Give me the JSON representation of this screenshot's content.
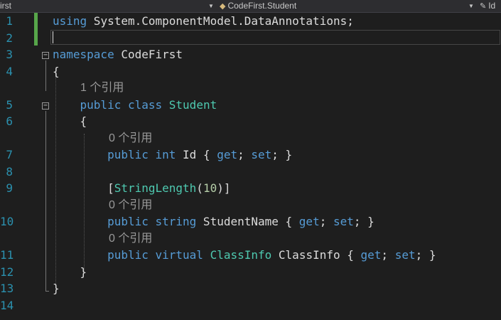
{
  "navbar": {
    "project_dropdown": "irst",
    "type_dropdown": "CodeFirst.Student",
    "member_dropdown": "Id"
  },
  "lines": [
    {
      "num": "1",
      "tokens": [
        {
          "t": "using",
          "c": "kw"
        },
        {
          "t": " System.ComponentModel.DataAnnotations;",
          "c": "pl"
        }
      ]
    },
    {
      "num": "2",
      "tokens": []
    },
    {
      "num": "3",
      "tokens": [
        {
          "t": "namespace",
          "c": "kw"
        },
        {
          "t": " CodeFirst",
          "c": "pl"
        }
      ]
    },
    {
      "num": "4",
      "tokens": [
        {
          "t": "{",
          "c": "pl"
        }
      ]
    },
    {
      "num": "",
      "lens": "1 个引用"
    },
    {
      "num": "5",
      "tokens": [
        {
          "t": "    public",
          "c": "kw"
        },
        {
          "t": " ",
          "c": "pl"
        },
        {
          "t": "class",
          "c": "kw"
        },
        {
          "t": " ",
          "c": "pl"
        },
        {
          "t": "Student",
          "c": "ty"
        }
      ]
    },
    {
      "num": "6",
      "tokens": [
        {
          "t": "    {",
          "c": "pl"
        }
      ]
    },
    {
      "num": "",
      "lens": "0 个引用"
    },
    {
      "num": "7",
      "tokens": [
        {
          "t": "        public",
          "c": "kw"
        },
        {
          "t": " ",
          "c": "pl"
        },
        {
          "t": "int",
          "c": "kw"
        },
        {
          "t": " Id { ",
          "c": "pl"
        },
        {
          "t": "get",
          "c": "kw"
        },
        {
          "t": "; ",
          "c": "pl"
        },
        {
          "t": "set",
          "c": "kw"
        },
        {
          "t": "; }",
          "c": "pl"
        }
      ]
    },
    {
      "num": "8",
      "tokens": []
    },
    {
      "num": "9",
      "tokens": [
        {
          "t": "        [",
          "c": "pl"
        },
        {
          "t": "StringLength",
          "c": "ty"
        },
        {
          "t": "(",
          "c": "pl"
        },
        {
          "t": "10",
          "c": "nm"
        },
        {
          "t": ")]",
          "c": "pl"
        }
      ]
    },
    {
      "num": "",
      "lens": "0 个引用"
    },
    {
      "num": "10",
      "tokens": [
        {
          "t": "        public",
          "c": "kw"
        },
        {
          "t": " ",
          "c": "pl"
        },
        {
          "t": "string",
          "c": "kw"
        },
        {
          "t": " StudentName { ",
          "c": "pl"
        },
        {
          "t": "get",
          "c": "kw"
        },
        {
          "t": "; ",
          "c": "pl"
        },
        {
          "t": "set",
          "c": "kw"
        },
        {
          "t": "; }",
          "c": "pl"
        }
      ]
    },
    {
      "num": "",
      "lens": "0 个引用"
    },
    {
      "num": "11",
      "tokens": [
        {
          "t": "        public",
          "c": "kw"
        },
        {
          "t": " ",
          "c": "pl"
        },
        {
          "t": "virtual",
          "c": "kw"
        },
        {
          "t": " ",
          "c": "pl"
        },
        {
          "t": "ClassInfo",
          "c": "ty"
        },
        {
          "t": " ClassInfo { ",
          "c": "pl"
        },
        {
          "t": "get",
          "c": "kw"
        },
        {
          "t": "; ",
          "c": "pl"
        },
        {
          "t": "set",
          "c": "kw"
        },
        {
          "t": "; }",
          "c": "pl"
        }
      ]
    },
    {
      "num": "12",
      "tokens": [
        {
          "t": "    }",
          "c": "pl"
        }
      ]
    },
    {
      "num": "13",
      "tokens": [
        {
          "t": "}",
          "c": "pl"
        }
      ]
    },
    {
      "num": "14",
      "tokens": []
    }
  ]
}
